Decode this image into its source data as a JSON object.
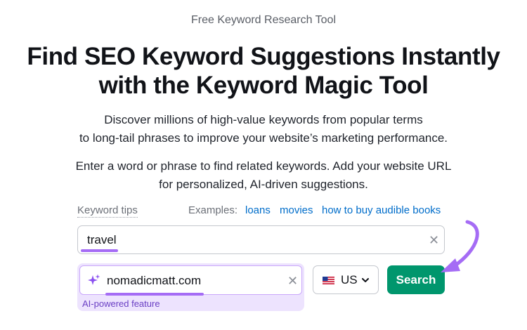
{
  "hero": {
    "eyebrow": "Free Keyword Research Tool",
    "headline_line1": "Find SEO Keyword Suggestions Instantly",
    "headline_line2": "with the Keyword Magic Tool",
    "description_line1": "Discover millions of high-value keywords from popular terms",
    "description_line2": "to long-tail phrases to improve your website’s marketing performance.",
    "instruction_line1": "Enter a word or phrase to find related keywords. Add your website URL",
    "instruction_line2": "for personalized, AI-driven suggestions."
  },
  "tips": {
    "keyword_tips_label": "Keyword tips",
    "examples_label": "Examples:",
    "examples": [
      "loans",
      "movies",
      "how to buy audible books"
    ]
  },
  "keyword_input": {
    "value": "travel",
    "clear_icon": "close-icon"
  },
  "url_input": {
    "value": "nomadicmatt.com",
    "icon": "sparkle-icon",
    "clear_icon": "close-icon",
    "caption": "AI-powered feature"
  },
  "country_select": {
    "value": "US",
    "flag_icon": "us-flag-icon",
    "chevron_icon": "chevron-down-icon"
  },
  "search_button": {
    "label": "Search"
  },
  "colors": {
    "accent_purple": "#a56cf5",
    "button_green": "#00966d",
    "link_blue": "#006dca"
  }
}
